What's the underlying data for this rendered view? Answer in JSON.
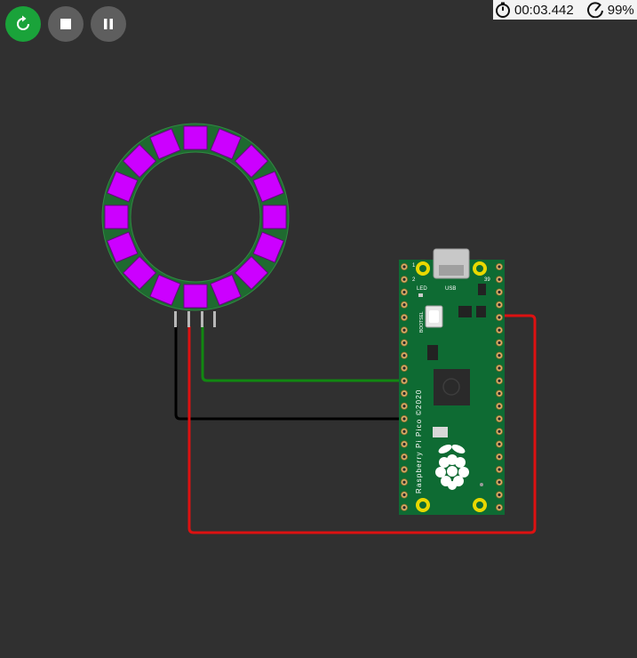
{
  "toolbar": {
    "restart_icon": "restart-icon",
    "stop_icon": "stop-icon",
    "pause_icon": "pause-icon"
  },
  "status": {
    "elapsed_time": "00:03.442",
    "speed": "99%",
    "timer_icon": "stopwatch-icon",
    "speed_icon": "gauge-icon"
  },
  "neopixel_ring": {
    "pixel_count": 16,
    "pixel_color": "#cc00ff",
    "board_color": "#1f6a30"
  },
  "pico": {
    "label": "Raspberry Pi Pico ©2020",
    "led_label": "LED",
    "usb_label": "USB",
    "bootsel_label": "BOOTSEL",
    "pin_1": "1",
    "pin_2": "2",
    "pin_39": "39",
    "board_color": "#0e6b33"
  },
  "wires": {
    "gnd_color": "#000000",
    "vcc_color": "#dd1111",
    "data_color": "#118811"
  }
}
